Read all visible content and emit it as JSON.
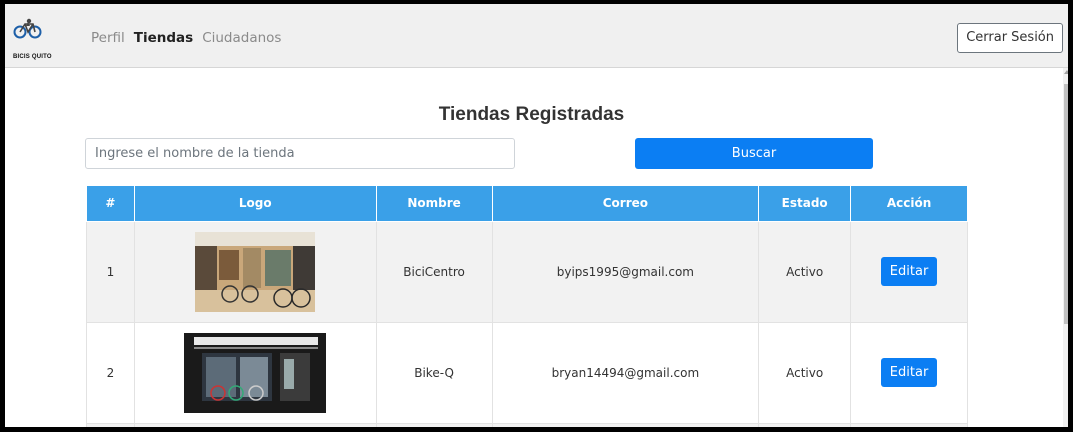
{
  "brand": {
    "text": "BICIS QUITO"
  },
  "nav": {
    "items": [
      {
        "label": "Perfil",
        "active": false
      },
      {
        "label": "Tiendas",
        "active": true
      },
      {
        "label": "Ciudadanos",
        "active": false
      }
    ],
    "logout_label": "Cerrar Sesión"
  },
  "main": {
    "title": "Tiendas Registradas",
    "search": {
      "placeholder": "Ingrese el nombre de la tienda",
      "value": ""
    },
    "search_button": "Buscar"
  },
  "table": {
    "headers": [
      "#",
      "Logo",
      "Nombre",
      "Correo",
      "Estado",
      "Acción"
    ],
    "rows": [
      {
        "num": "1",
        "nombre": "BiciCentro",
        "correo": "byips1995@gmail.com",
        "estado": "Activo",
        "accion": "Editar"
      },
      {
        "num": "2",
        "nombre": "Bike-Q",
        "correo": "bryan14494@gmail.com",
        "estado": "Activo",
        "accion": "Editar"
      }
    ]
  },
  "colors": {
    "primary": "#0b7ef3",
    "table_header": "#3aa0e8",
    "navbar_bg": "#f0f0f0"
  }
}
